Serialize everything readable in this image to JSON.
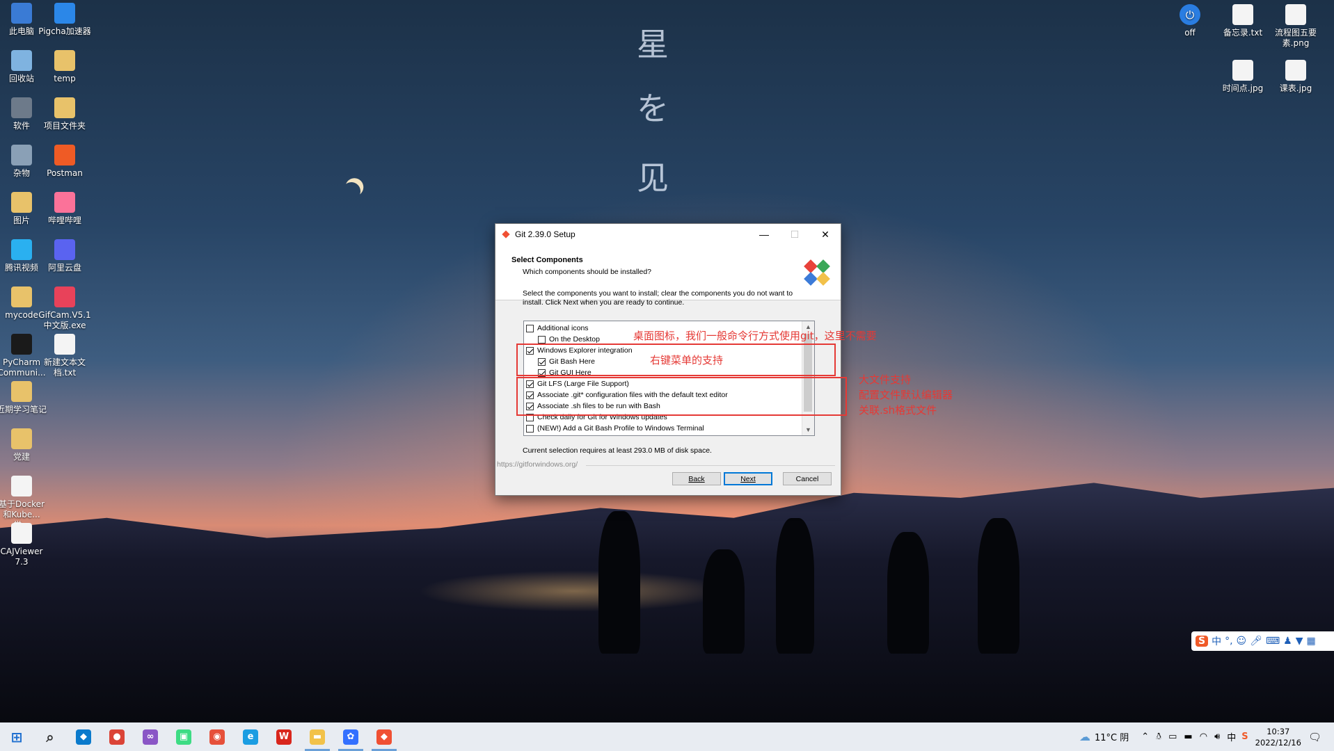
{
  "wallpaper": {
    "text": [
      "星",
      "を",
      "见"
    ]
  },
  "desktop_left": [
    {
      "label": "此电脑",
      "icon": "computer-icon",
      "color": "#3a7bd5"
    },
    {
      "label": "Pigcha加速器",
      "icon": "pigcha-icon",
      "color": "#2b87e8"
    },
    {
      "label": "回收站",
      "icon": "recycle-bin-icon",
      "color": "#7fb3e0"
    },
    {
      "label": "temp",
      "icon": "folder-icon",
      "color": "#e8c26a"
    },
    {
      "label": "软件",
      "icon": "dvd-drive-icon",
      "color": "#6d7a8a"
    },
    {
      "label": "项目文件夹",
      "icon": "folder-icon",
      "color": "#e8c26a"
    },
    {
      "label": "杂物",
      "icon": "user-folder-icon",
      "color": "#8aa0b6"
    },
    {
      "label": "Postman",
      "icon": "postman-icon",
      "color": "#ef5b25"
    },
    {
      "label": "图片",
      "icon": "folder-icon",
      "color": "#e8c26a"
    },
    {
      "label": "哔哩哔哩",
      "icon": "bilibili-icon",
      "color": "#fb7299"
    },
    {
      "label": "腾讯视频",
      "icon": "tencent-video-icon",
      "color": "#2ab0f0"
    },
    {
      "label": "阿里云盘",
      "icon": "aliyun-drive-icon",
      "color": "#5a63f0"
    },
    {
      "label": "mycode",
      "icon": "folder-icon",
      "color": "#e8c26a"
    },
    {
      "label": "GifCam.V5.1中文版.exe",
      "icon": "gifcam-icon",
      "color": "#e8425a"
    },
    {
      "label": "PyCharm Communi...",
      "icon": "pycharm-icon",
      "color": "#1a1a1a"
    },
    {
      "label": "新建文本文档.txt",
      "icon": "text-file-icon",
      "color": "#f4f4f4"
    },
    {
      "label": "近期学习笔记",
      "icon": "folder-icon",
      "color": "#e8c26a"
    },
    {
      "label": "党建",
      "icon": "folder-icon",
      "color": "#e8c26a"
    },
    {
      "label": "基于Docker和Kube...学...",
      "icon": "document-icon",
      "color": "#f4f4f4"
    },
    {
      "label": "CAJViewer 7.3",
      "icon": "document-icon",
      "color": "#f4f4f4"
    }
  ],
  "desktop_right": [
    {
      "label": "off",
      "icon": "power-icon",
      "color": "#2a7de1"
    },
    {
      "label": "备忘录.txt",
      "icon": "text-file-icon",
      "color": "#f4f4f4"
    },
    {
      "label": "流程图五要素.png",
      "icon": "image-file-icon",
      "color": "#f4f4f4"
    },
    {
      "label": "时间点.jpg",
      "icon": "image-file-icon",
      "color": "#f4f4f4"
    },
    {
      "label": "课表.jpg",
      "icon": "image-file-icon",
      "color": "#f4f4f4"
    }
  ],
  "dialog": {
    "title": "Git 2.39.0 Setup",
    "heading": "Select Components",
    "subheading": "Which components should be installed?",
    "instructions": "Select the components you want to install; clear the components you do not want to install. Click Next when you are ready to continue.",
    "components": [
      {
        "label": "Additional icons",
        "checked": false,
        "indent": 0
      },
      {
        "label": "On the Desktop",
        "checked": false,
        "indent": 1
      },
      {
        "label": "Windows Explorer integration",
        "checked": true,
        "indent": 0
      },
      {
        "label": "Git Bash Here",
        "checked": true,
        "indent": 1
      },
      {
        "label": "Git GUI Here",
        "checked": true,
        "indent": 1
      },
      {
        "label": "Git LFS (Large File Support)",
        "checked": true,
        "indent": 0
      },
      {
        "label": "Associate .git* configuration files with the default text editor",
        "checked": true,
        "indent": 0
      },
      {
        "label": "Associate .sh files to be run with Bash",
        "checked": true,
        "indent": 0
      },
      {
        "label": "Check daily for Git for Windows updates",
        "checked": false,
        "indent": 0
      },
      {
        "label": "(NEW!) Add a Git Bash Profile to Windows Terminal",
        "checked": false,
        "indent": 0
      }
    ],
    "requirement": "Current selection requires at least 293.0 MB of disk space.",
    "url": "https://gitforwindows.org/",
    "back_label": "Back",
    "next_label": "Next",
    "cancel_label": "Cancel"
  },
  "annotations": {
    "desktop_icon_note": "桌面图标，我们一般命令行方式使用git，这里不需要",
    "context_menu_note": "右键菜单的支持",
    "lfs_note": "大文件支持",
    "editor_note": "配置文件默认编辑器",
    "sh_note": "关联.sh格式文件",
    "color": "#e53935"
  },
  "taskbar": {
    "items": [
      {
        "name": "start-icon",
        "glyph": "⊞",
        "color": "#1e6fd0"
      },
      {
        "name": "search-icon",
        "glyph": "⌕",
        "color": "#333333"
      },
      {
        "name": "vscode-icon",
        "glyph": "◆",
        "color": "#0a7acc"
      },
      {
        "name": "chrome-icon",
        "glyph": "●",
        "color": "#db4437"
      },
      {
        "name": "visual-studio-icon",
        "glyph": "∞",
        "color": "#8a56c6"
      },
      {
        "name": "android-studio-icon",
        "glyph": "▣",
        "color": "#3ddc84"
      },
      {
        "name": "browser-icon",
        "glyph": "◉",
        "color": "#e6503a"
      },
      {
        "name": "edge-icon",
        "glyph": "e",
        "color": "#1b9de2"
      },
      {
        "name": "wps-icon",
        "glyph": "W",
        "color": "#d9261c"
      },
      {
        "name": "file-explorer-icon",
        "glyph": "▬",
        "color": "#f2c24a"
      },
      {
        "name": "feishu-icon",
        "glyph": "✿",
        "color": "#3370ff"
      },
      {
        "name": "git-setup-icon",
        "glyph": "◆",
        "color": "#f05033"
      }
    ],
    "weather": "11°C 阴",
    "time": "10:37",
    "date": "2022/12/16"
  },
  "ime_toolbar": {
    "logo": "S",
    "mode": "中",
    "punct": "°,",
    "icons": [
      "emoji-icon",
      "microphone-icon",
      "keyboard-icon",
      "user-icon",
      "skin-icon",
      "grid-icon"
    ]
  }
}
